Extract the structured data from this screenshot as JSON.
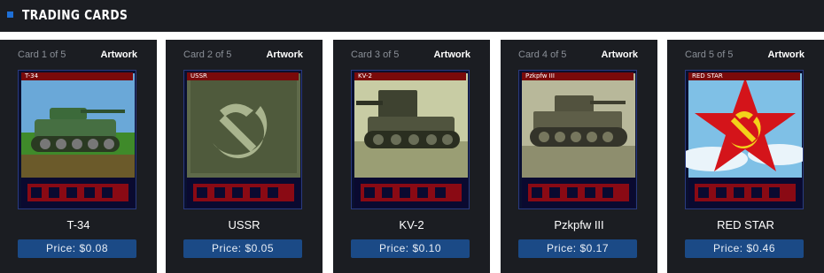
{
  "header": {
    "title": "TRADING CARDS",
    "accent_color": "#1e6fd6"
  },
  "cards": [
    {
      "count": "Card 1 of 5",
      "artwork_label": "Artwork",
      "tag": "T-34",
      "name": "T-34",
      "price": "Price: $0.08",
      "art_icon": "tank-icon"
    },
    {
      "count": "Card 2 of 5",
      "artwork_label": "Artwork",
      "tag": "USSR",
      "name": "USSR",
      "price": "Price: $0.05",
      "art_icon": "hammer-sickle-icon"
    },
    {
      "count": "Card 3 of 5",
      "artwork_label": "Artwork",
      "tag": "KV-2",
      "name": "KV-2",
      "price": "Price: $0.10",
      "art_icon": "tank-icon"
    },
    {
      "count": "Card 4 of 5",
      "artwork_label": "Artwork",
      "tag": "Pzkpfw III",
      "name": "Pzkpfw III",
      "price": "Price: $0.17",
      "art_icon": "tank-icon"
    },
    {
      "count": "Card 5 of 5",
      "artwork_label": "Artwork",
      "tag": "RED STAR",
      "name": "RED STAR",
      "price": "Price: $0.46",
      "art_icon": "red-star-icon"
    }
  ],
  "colors": {
    "panel_bg": "#1b1d22",
    "price_button": "#1b4a86",
    "card_tag": "#7a0a0a"
  }
}
